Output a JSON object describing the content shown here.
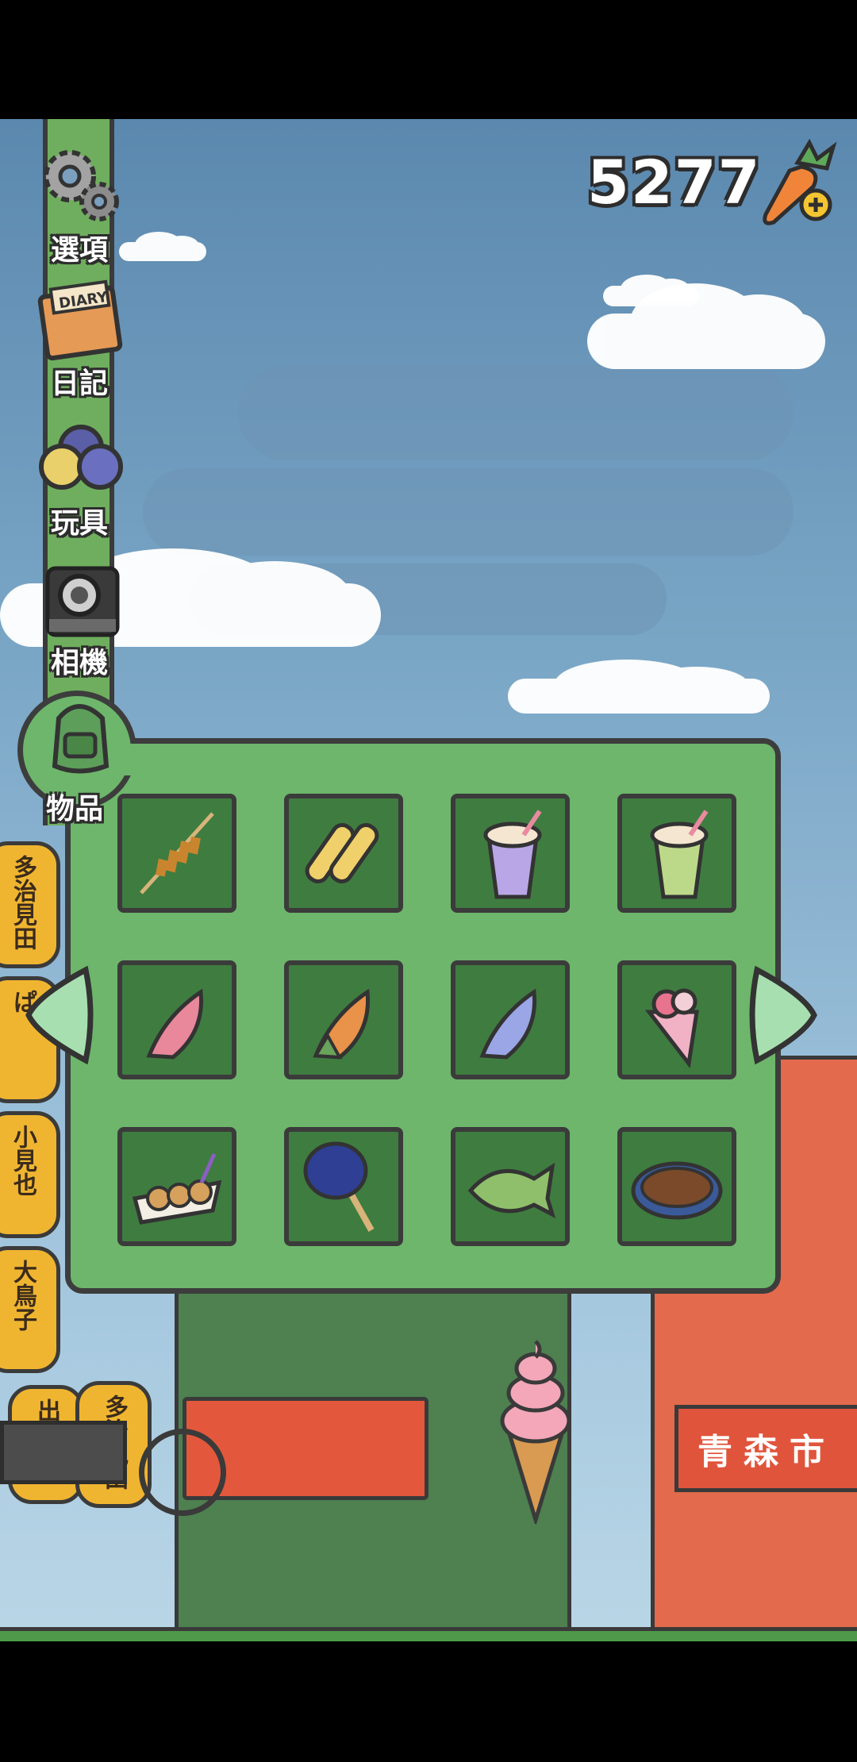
{
  "currency": {
    "amount": "5277",
    "add_icon": "carrot-plus-icon"
  },
  "menu": {
    "items": [
      {
        "label": "選項",
        "icon": "gear-icon"
      },
      {
        "label": "日記",
        "icon": "diary-icon"
      },
      {
        "label": "玩具",
        "icon": "toy-balls-icon"
      },
      {
        "label": "相機",
        "icon": "camera-icon"
      },
      {
        "label": "物品",
        "icon": "backpack-icon"
      }
    ]
  },
  "inventory": {
    "items": [
      {
        "name": "tornado-potato"
      },
      {
        "name": "grilled-corn"
      },
      {
        "name": "blueberry-shake"
      },
      {
        "name": "matcha-shake"
      },
      {
        "name": "strawberry-taiyaki-cone"
      },
      {
        "name": "carrot-taiyaki-cone"
      },
      {
        "name": "blueberry-taiyaki-cone"
      },
      {
        "name": "ice-cream-crepe"
      },
      {
        "name": "takoyaki"
      },
      {
        "name": "fireworks-fan"
      },
      {
        "name": "matcha-taiyaki"
      },
      {
        "name": "yakisoba"
      }
    ],
    "prev_icon": "arrow-left-icon",
    "next_icon": "arrow-right-icon"
  },
  "background": {
    "lanterns": [
      "多治見田",
      "ぱ",
      "小見也",
      "大鳥子",
      "出正見",
      "多治見田"
    ],
    "banner": "青森市"
  }
}
